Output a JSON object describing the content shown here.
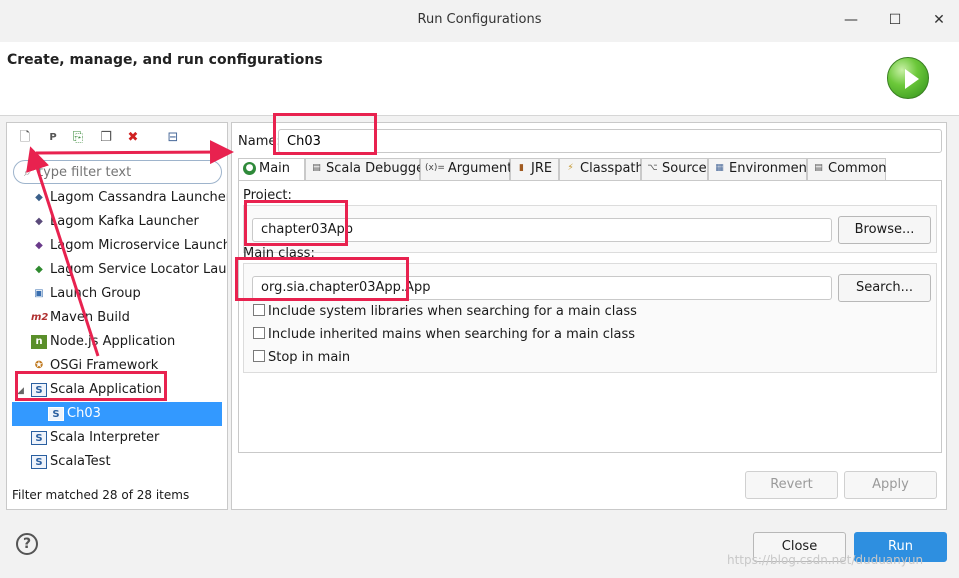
{
  "window": {
    "title": "Run Configurations",
    "minimize": "—",
    "maximize": "☐",
    "close": "✕"
  },
  "header": {
    "title": "Create, manage, and run configurations"
  },
  "left": {
    "toolbar": [
      {
        "name": "new-launch-config-icon",
        "glyph": "🗋"
      },
      {
        "name": "new-prototype-icon",
        "glyph": "P"
      },
      {
        "name": "export-icon",
        "glyph": "⎘"
      },
      {
        "name": "duplicate-icon",
        "glyph": "❐"
      },
      {
        "name": "delete-icon",
        "glyph": "✖"
      },
      {
        "name": "collapse-all-icon",
        "glyph": "⊟"
      }
    ],
    "filter_placeholder": "type filter text",
    "tree": [
      {
        "label": "Lagom Cassandra Launcher",
        "icon": "cassandra-icon",
        "glyph": "◆",
        "color": "#3a5f8a"
      },
      {
        "label": "Lagom Kafka Launcher",
        "icon": "kafka-icon",
        "glyph": "◆",
        "color": "#5a4a7a"
      },
      {
        "label": "Lagom Microservice Launcher",
        "icon": "microservice-icon",
        "glyph": "◆",
        "color": "#6a3a8a"
      },
      {
        "label": "Lagom Service Locator Launcher",
        "icon": "service-locator-icon",
        "glyph": "◆",
        "color": "#2f8a2f"
      },
      {
        "label": "Launch Group",
        "icon": "launch-group-icon",
        "glyph": "▣",
        "color": "#3a6fb0"
      },
      {
        "label": "Maven Build",
        "icon": "maven-icon",
        "glyph": "m2",
        "color": "#b03030"
      },
      {
        "label": "Node.js Application",
        "icon": "nodejs-icon",
        "glyph": "n",
        "color": "#5a8f2a"
      },
      {
        "label": "OSGi Framework",
        "icon": "osgi-icon",
        "glyph": "✪",
        "color": "#c07a20"
      },
      {
        "label": "Scala Application",
        "icon": "scala-app-icon",
        "glyph": "S",
        "color": "#2a5fa0"
      },
      {
        "label": "Ch03",
        "icon": "scala-config-icon",
        "glyph": "S",
        "color": "#ffffff"
      },
      {
        "label": "Scala Interpreter",
        "icon": "scala-interpreter-icon",
        "glyph": "S",
        "color": "#2a5fa0"
      },
      {
        "label": "ScalaTest",
        "icon": "scalatest-icon",
        "glyph": "S",
        "color": "#2a5fa0"
      }
    ],
    "filter_status": "Filter matched 28 of 28 items"
  },
  "right": {
    "name_label": "Name:",
    "name_value": "Ch03",
    "tabs": [
      {
        "label": "Main",
        "icon": "main-tab-icon",
        "glyph": "●"
      },
      {
        "label": "Scala Debugger",
        "icon": "debugger-icon",
        "glyph": "▤"
      },
      {
        "label": "Arguments",
        "icon": "arguments-icon",
        "glyph": "(x)="
      },
      {
        "label": "JRE",
        "icon": "jre-icon",
        "glyph": "▮"
      },
      {
        "label": "Classpath",
        "icon": "classpath-icon",
        "glyph": "⚡"
      },
      {
        "label": "Source",
        "icon": "source-icon",
        "glyph": "⌥"
      },
      {
        "label": "Environment",
        "icon": "environment-icon",
        "glyph": "▦"
      },
      {
        "label": "Common",
        "icon": "common-icon",
        "glyph": "▤"
      }
    ],
    "project": {
      "label": "Project:",
      "value": "chapter03App",
      "button": "Browse..."
    },
    "main_class": {
      "label": "Main class:",
      "value": "org.sia.chapter03App.App",
      "button": "Search..."
    },
    "checkboxes": [
      {
        "label": "Include system libraries when searching for a main class",
        "checked": false
      },
      {
        "label": "Include inherited mains when searching for a main class",
        "checked": false
      },
      {
        "label": "Stop in main",
        "checked": false
      }
    ],
    "revert": "Revert",
    "apply": "Apply"
  },
  "footer": {
    "close": "Close",
    "run": "Run",
    "help": "?"
  },
  "watermark": "https://blog.csdn.net/duduanyun",
  "colors": {
    "highlight": "#e8224f",
    "selection": "#3399ff",
    "run_button": "#2e8fe0"
  }
}
